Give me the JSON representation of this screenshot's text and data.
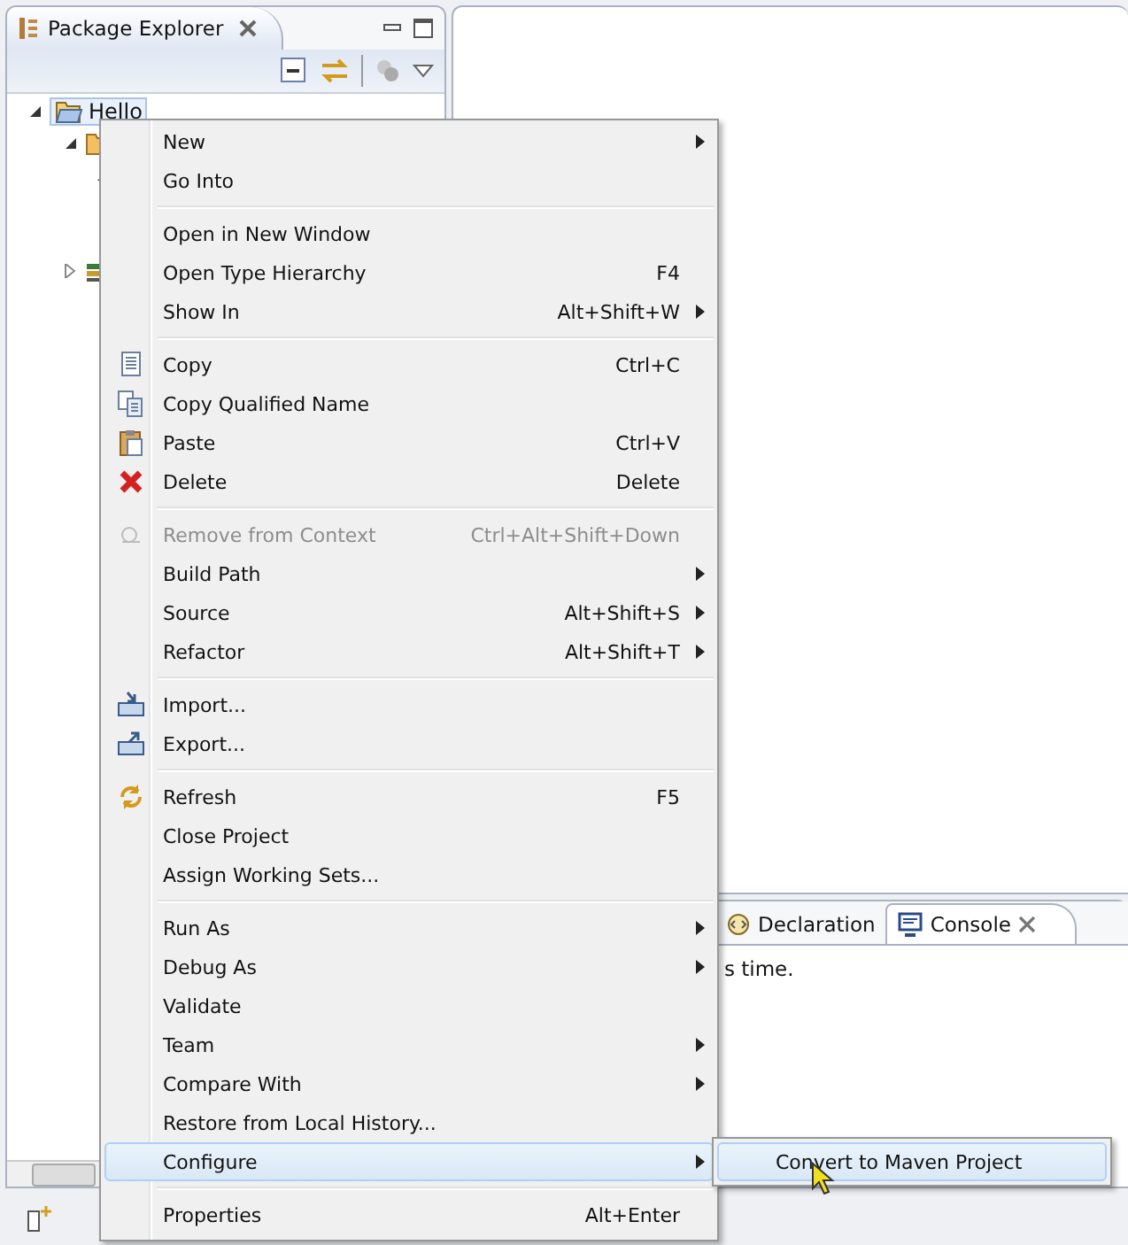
{
  "package_explorer": {
    "title": "Package Explorer",
    "tree": [
      {
        "label": "Hello",
        "selected": true,
        "expanded": true
      }
    ]
  },
  "bottom_panel": {
    "tabs": [
      {
        "label": "Declaration",
        "selected": false
      },
      {
        "label": "Console",
        "selected": true
      }
    ],
    "console_text": "s time."
  },
  "context_menu": {
    "groups": [
      [
        {
          "label": "New",
          "submenu": true,
          "disabled": false,
          "selected": false
        },
        {
          "label": "Go Into",
          "submenu": false,
          "disabled": false,
          "selected": false
        }
      ],
      [
        {
          "label": "Open in New Window",
          "submenu": false,
          "disabled": false,
          "selected": false
        },
        {
          "label": "Open Type Hierarchy",
          "shortcut": "F4",
          "submenu": false,
          "disabled": false,
          "selected": false
        },
        {
          "label": "Show In",
          "shortcut": "Alt+Shift+W",
          "submenu": true,
          "disabled": false,
          "selected": false
        }
      ],
      [
        {
          "label": "Copy",
          "shortcut": "Ctrl+C",
          "submenu": false,
          "disabled": false,
          "selected": false
        },
        {
          "label": "Copy Qualified Name",
          "submenu": false,
          "disabled": false,
          "selected": false
        },
        {
          "label": "Paste",
          "shortcut": "Ctrl+V",
          "submenu": false,
          "disabled": false,
          "selected": false
        },
        {
          "label": "Delete",
          "shortcut": "Delete",
          "submenu": false,
          "disabled": false,
          "selected": false
        }
      ],
      [
        {
          "label": "Remove from Context",
          "shortcut": "Ctrl+Alt+Shift+Down",
          "submenu": false,
          "disabled": true,
          "selected": false
        },
        {
          "label": "Build Path",
          "submenu": true,
          "disabled": false,
          "selected": false
        },
        {
          "label": "Source",
          "shortcut": "Alt+Shift+S",
          "submenu": true,
          "disabled": false,
          "selected": false
        },
        {
          "label": "Refactor",
          "shortcut": "Alt+Shift+T",
          "submenu": true,
          "disabled": false,
          "selected": false
        }
      ],
      [
        {
          "label": "Import...",
          "submenu": false,
          "disabled": false,
          "selected": false
        },
        {
          "label": "Export...",
          "submenu": false,
          "disabled": false,
          "selected": false
        }
      ],
      [
        {
          "label": "Refresh",
          "shortcut": "F5",
          "submenu": false,
          "disabled": false,
          "selected": false
        },
        {
          "label": "Close Project",
          "submenu": false,
          "disabled": false,
          "selected": false
        },
        {
          "label": "Assign Working Sets...",
          "submenu": false,
          "disabled": false,
          "selected": false
        }
      ],
      [
        {
          "label": "Run As",
          "submenu": true,
          "disabled": false,
          "selected": false
        },
        {
          "label": "Debug As",
          "submenu": true,
          "disabled": false,
          "selected": false
        },
        {
          "label": "Validate",
          "submenu": false,
          "disabled": false,
          "selected": false
        },
        {
          "label": "Team",
          "submenu": true,
          "disabled": false,
          "selected": false
        },
        {
          "label": "Compare With",
          "submenu": true,
          "disabled": false,
          "selected": false
        },
        {
          "label": "Restore from Local History...",
          "submenu": false,
          "disabled": false,
          "selected": false
        },
        {
          "label": "Configure",
          "submenu": true,
          "disabled": false,
          "selected": true
        }
      ],
      [
        {
          "label": "Properties",
          "shortcut": "Alt+Enter",
          "submenu": false,
          "disabled": false,
          "selected": false
        }
      ]
    ]
  },
  "submenu": {
    "items": [
      {
        "label": "Convert to Maven Project",
        "selected": true
      }
    ]
  }
}
